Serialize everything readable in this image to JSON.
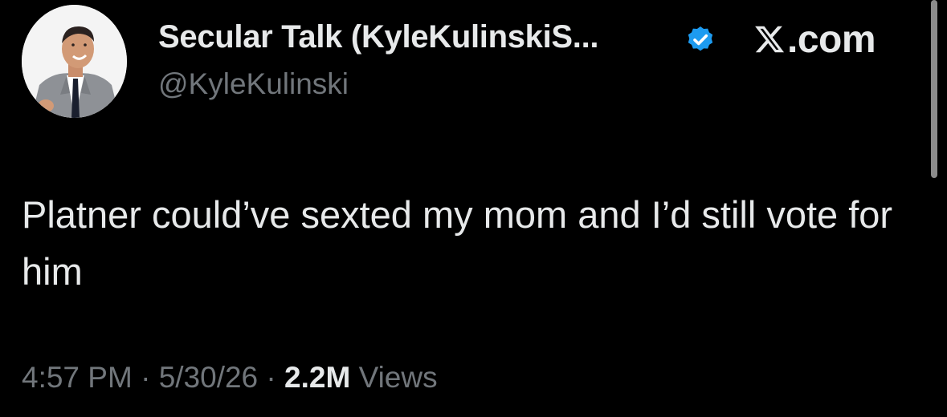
{
  "author": {
    "display_name": "Secular Talk (KyleKulinskiS...",
    "handle": "@KyleKulinski",
    "verified": true,
    "avatar_icon": "profile-photo-man-in-suit"
  },
  "brand": {
    "label": ".com",
    "logo_icon": "x-logo-icon"
  },
  "tweet": {
    "text": "Platner could’ve sexted my mom and I’d still vote for him",
    "time": "4:57 PM",
    "date": "5/30/26",
    "separator": "·",
    "views_count": "2.2M",
    "views_label": "Views"
  },
  "colors": {
    "background": "#000000",
    "primary_text": "#e7e9ea",
    "secondary_text": "#71767b",
    "verified_badge": "#1d9bf0"
  }
}
